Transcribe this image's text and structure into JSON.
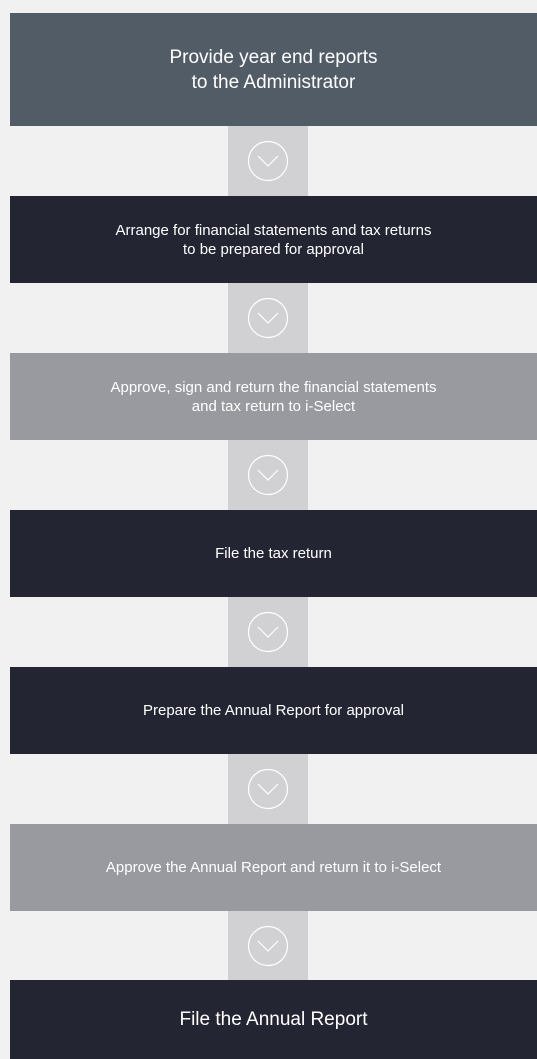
{
  "colors": {
    "background": "#f1f1f1",
    "header_box": "#525c67",
    "dark_box": "#232532",
    "grey_box": "#999a9f",
    "connector": "#d1d1d3",
    "text": "#ffffff"
  },
  "connector_icon": "chevron-down-circle-icon",
  "steps": [
    {
      "label": "Provide year end reports\nto the Administrator",
      "style": "header"
    },
    {
      "label": "Arrange for financial statements and tax returns\nto be prepared for approval",
      "style": "dark"
    },
    {
      "label": "Approve, sign and return the financial statements\nand tax return to i-Select",
      "style": "grey"
    },
    {
      "label": "File the tax return",
      "style": "dark"
    },
    {
      "label": "Prepare the Annual Report for approval",
      "style": "dark"
    },
    {
      "label": "Approve the Annual Report and return it to i-Select",
      "style": "grey"
    },
    {
      "label": "File the Annual Report",
      "style": "final"
    }
  ]
}
